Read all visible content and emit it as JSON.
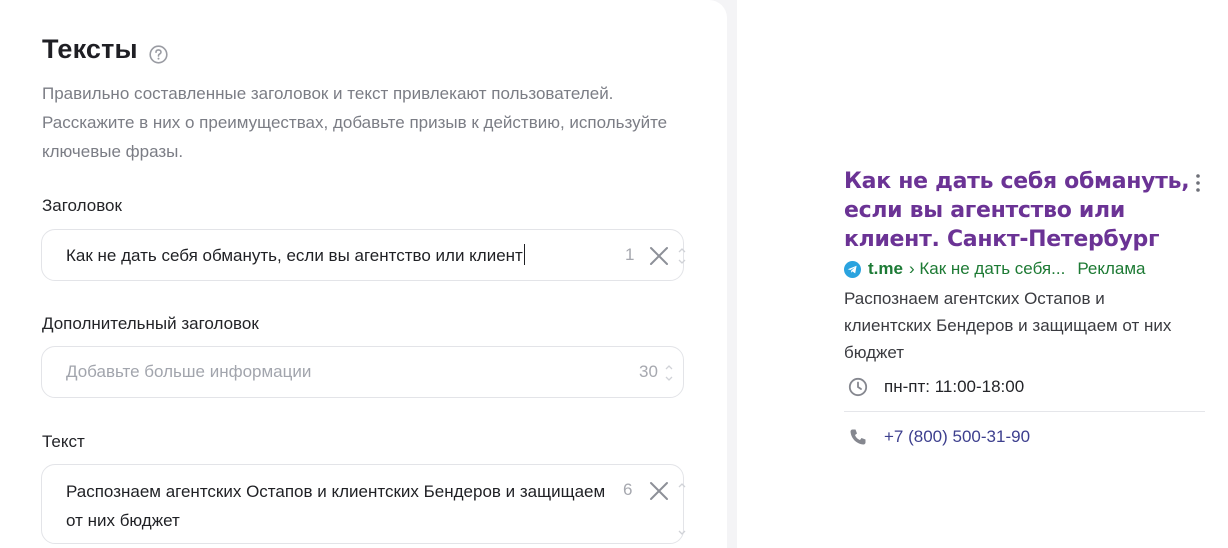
{
  "texts_section": {
    "title": "Тексты",
    "description": "Правильно составленные заголовок и текст привлекают пользователей. Расскажите в них о преимуществах, добавьте призыв к действию, используйте ключевые фразы."
  },
  "headline_field": {
    "label": "Заголовок",
    "value": "Как не дать себя обмануть, если вы агентство или клиент",
    "counter": "1"
  },
  "extra_headline_field": {
    "label": "Дополнительный заголовок",
    "placeholder": "Добавьте больше информации",
    "counter": "30"
  },
  "text_field": {
    "label": "Текст",
    "value": "Распознаем агентских Остапов и клиентских Бендеров и защищаем от них бюджет",
    "counter": "6"
  },
  "preview": {
    "title": "Как не дать себя обмануть, если вы агентство или клиент. Санкт-Петербург",
    "domain": "t.me",
    "path": "› Как не дать себя...",
    "ad_label": "Реклама",
    "text": "Распознаем агентских Остапов и клиентских Бендеров и защищаем от них бюджет",
    "hours": "пн-пт: 11:00-18:00",
    "phone": "+7 (800) 500-31-90"
  },
  "icons": {
    "help": "help-circle-icon",
    "clear": "close-icon",
    "more": "more-vertical-icon",
    "telegram": "telegram-icon",
    "clock": "clock-icon",
    "phone": "phone-icon"
  },
  "colors": {
    "ad_title": "#6b3395",
    "ad_url": "#1d7a34",
    "phone": "#3d3f8e"
  }
}
